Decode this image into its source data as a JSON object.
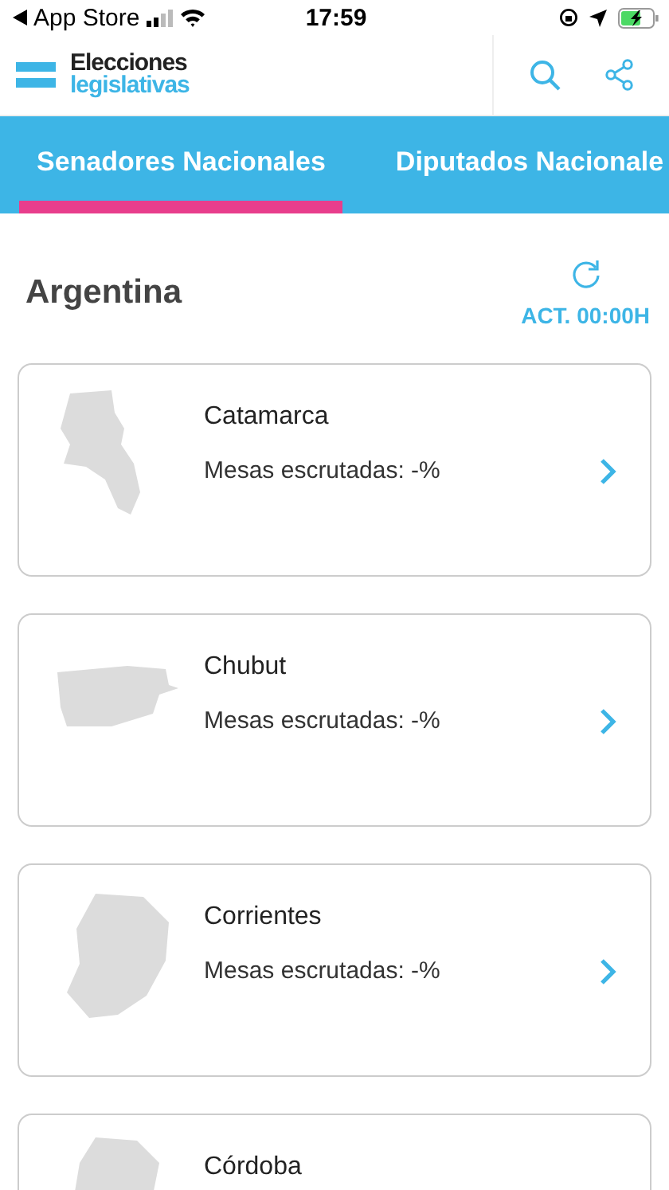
{
  "status_bar": {
    "back_label": "App Store",
    "time": "17:59"
  },
  "header": {
    "logo_top": "Elecciones",
    "logo_bottom": "legislativas"
  },
  "tabs": [
    {
      "label": "Senadores Nacionales",
      "selected": true
    },
    {
      "label": "Diputados Nacionale",
      "selected": false
    }
  ],
  "region": {
    "title": "Argentina",
    "update_label": "ACT. 00:00H"
  },
  "provinces": [
    {
      "name": "Catamarca",
      "tables": "Mesas escrutadas: -%"
    },
    {
      "name": "Chubut",
      "tables": "Mesas escrutadas: -%"
    },
    {
      "name": "Corrientes",
      "tables": "Mesas escrutadas: -%"
    },
    {
      "name": "Córdoba"
    }
  ]
}
